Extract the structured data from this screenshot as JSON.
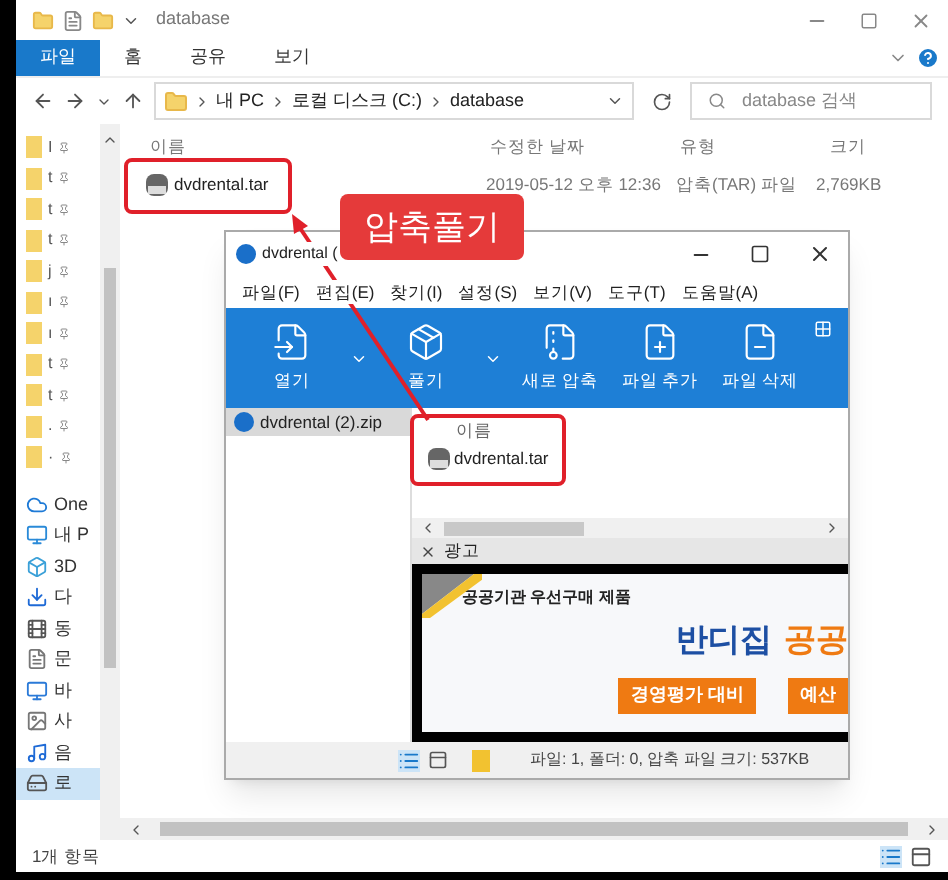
{
  "explorer": {
    "title": "database",
    "ribbon_tabs": [
      {
        "label": "파일",
        "selected": true
      },
      {
        "label": "홈",
        "selected": false
      },
      {
        "label": "공유",
        "selected": false
      },
      {
        "label": "보기",
        "selected": false
      }
    ],
    "address": [
      "내 PC",
      "로컬 디스크 (C:)",
      "database"
    ],
    "search": {
      "placeholder": "database 검색"
    },
    "nav_items": [
      {
        "kind": "pinned",
        "label": "I"
      },
      {
        "kind": "pinned",
        "label": "t"
      },
      {
        "kind": "pinned",
        "label": "t"
      },
      {
        "kind": "pinned",
        "label": "t"
      },
      {
        "kind": "pinned",
        "label": "j"
      },
      {
        "kind": "pinned",
        "label": "ı"
      },
      {
        "kind": "pinned",
        "label": "ı"
      },
      {
        "kind": "pinned",
        "label": "t"
      },
      {
        "kind": "pinned",
        "label": "t"
      },
      {
        "kind": "pinned",
        "label": "."
      },
      {
        "kind": "pinned",
        "label": "·"
      },
      {
        "kind": "cloud",
        "label": "One"
      },
      {
        "kind": "pc",
        "label": "내 P"
      },
      {
        "kind": "cube",
        "label": "3D"
      },
      {
        "kind": "download",
        "label": "다"
      },
      {
        "kind": "video",
        "label": "동"
      },
      {
        "kind": "doc",
        "label": "문"
      },
      {
        "kind": "desktop",
        "label": "바"
      },
      {
        "kind": "image",
        "label": "사"
      },
      {
        "kind": "music",
        "label": "음"
      },
      {
        "kind": "drive",
        "label": "로"
      }
    ],
    "columns": [
      "이름",
      "수정한 날짜",
      "유형",
      "크기"
    ],
    "files": [
      {
        "name": "dvdrental.tar",
        "date": "2019-05-12 오후 12:36",
        "type": "압축(TAR) 파일",
        "size": "2,769KB"
      }
    ],
    "status": "1개 항목"
  },
  "callout": {
    "text": "압축풀기"
  },
  "bandizip": {
    "title": "dvdrental (",
    "menu": [
      "파일(F)",
      "편집(E)",
      "찾기(I)",
      "설정(S)",
      "보기(V)",
      "도구(T)",
      "도움말(A)"
    ],
    "toolbar": [
      {
        "kind": "open",
        "label": "열기"
      },
      {
        "kind": "extract",
        "label": "풀기"
      },
      {
        "kind": "new",
        "label": "새로 압축"
      },
      {
        "kind": "add",
        "label": "파일 추가"
      },
      {
        "kind": "delete",
        "label": "파일 삭제"
      }
    ],
    "archives": [
      {
        "label": "dvdrental (2).zip",
        "selected": true
      }
    ],
    "list_header": "이름",
    "files": [
      {
        "name": "dvdrental.tar"
      }
    ],
    "ad": {
      "label": "광고",
      "tagline": "공공기관 우선구매 제품",
      "headline_1": "반디집",
      "headline_2": "공공",
      "buttons": [
        "경영평가 대비",
        "예산"
      ]
    },
    "status": "파일: 1, 폴더: 0, 압축 파일 크기: 537KB"
  }
}
